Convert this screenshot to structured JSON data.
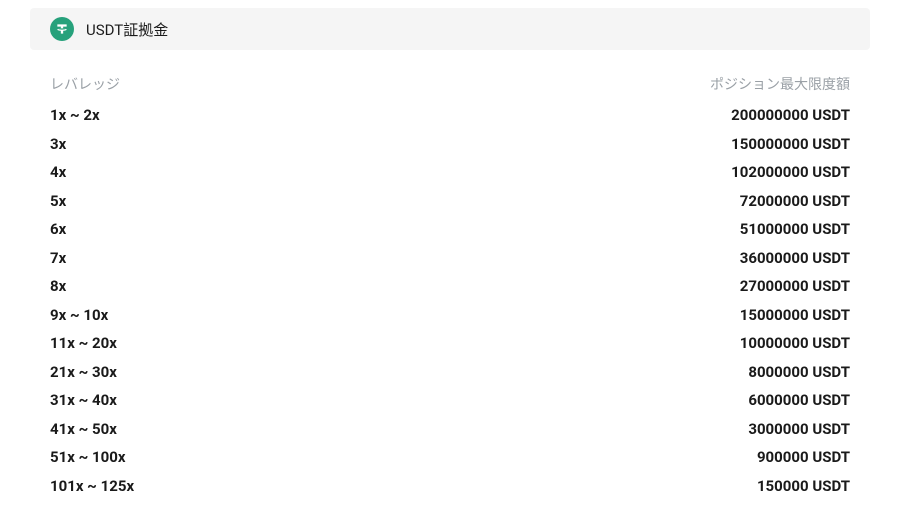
{
  "header": {
    "title": "USDT証拠金",
    "icon_name": "tether-icon"
  },
  "table": {
    "columns": {
      "leverage": "レバレッジ",
      "max_position": "ポジション最大限度額"
    },
    "rows": [
      {
        "leverage": "1x ~ 2x",
        "max_position": "200000000 USDT"
      },
      {
        "leverage": "3x",
        "max_position": "150000000 USDT"
      },
      {
        "leverage": "4x",
        "max_position": "102000000 USDT"
      },
      {
        "leverage": "5x",
        "max_position": "72000000 USDT"
      },
      {
        "leverage": "6x",
        "max_position": "51000000 USDT"
      },
      {
        "leverage": "7x",
        "max_position": "36000000 USDT"
      },
      {
        "leverage": "8x",
        "max_position": "27000000 USDT"
      },
      {
        "leverage": "9x ~ 10x",
        "max_position": "15000000 USDT"
      },
      {
        "leverage": "11x ~ 20x",
        "max_position": "10000000 USDT"
      },
      {
        "leverage": "21x ~ 30x",
        "max_position": "8000000 USDT"
      },
      {
        "leverage": "31x ~ 40x",
        "max_position": "6000000 USDT"
      },
      {
        "leverage": "41x ~ 50x",
        "max_position": "3000000 USDT"
      },
      {
        "leverage": "51x ~ 100x",
        "max_position": "900000 USDT"
      },
      {
        "leverage": "101x ~ 125x",
        "max_position": "150000 USDT"
      }
    ]
  }
}
